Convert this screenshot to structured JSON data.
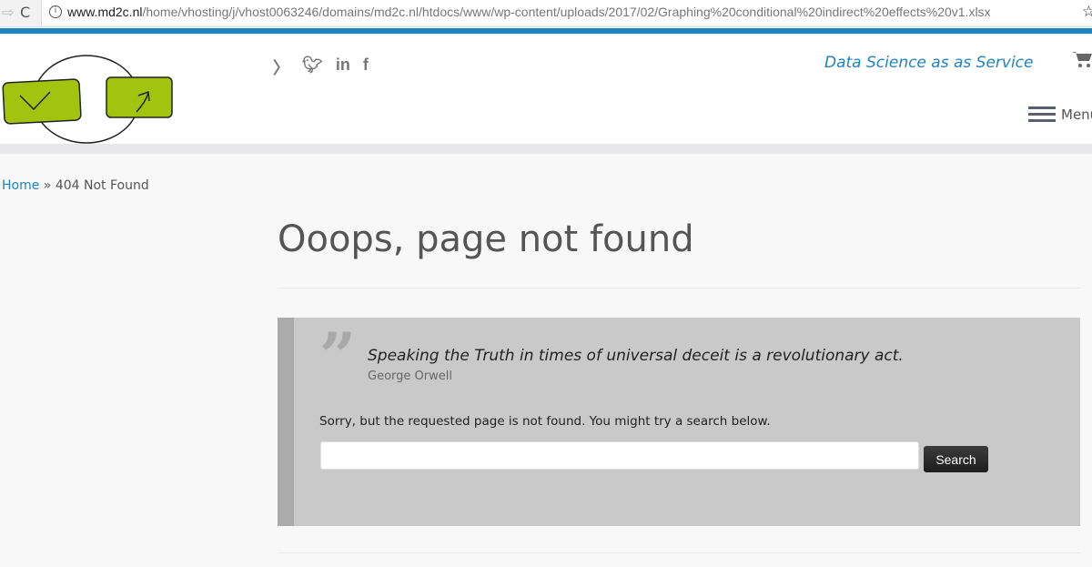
{
  "browser": {
    "url_host": "www.md2c.nl",
    "url_path": "/home/vhosting/j/vhost0063246/domains/md2c.nl/htdocs/www/wp-content/uploads/2017/02/Graphing%20conditional%20indirect%20effects%20v1.xlsx"
  },
  "header": {
    "tagline": "Data Science as as Service",
    "menu_label": "Menu",
    "social": [
      "rss-icon",
      "twitter-icon",
      "linkedin-icon",
      "facebook-icon"
    ],
    "brand_color": "#1e83c1",
    "logo_green": "#a4c30f"
  },
  "breadcrumb": {
    "home": "Home",
    "sep": " » ",
    "current": "404 Not Found"
  },
  "main": {
    "title": "Ooops, page not found",
    "quote": "Speaking the Truth in times of universal deceit is a revolutionary act.",
    "author": "George Orwell",
    "message": "Sorry, but the requested page is not found. You might try a search below.",
    "search_value": "",
    "search_button": "Search"
  }
}
